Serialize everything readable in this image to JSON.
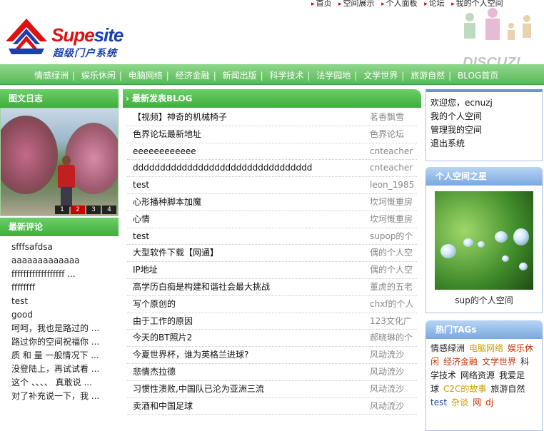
{
  "top_links": [
    "首页",
    "空间展示",
    "个人面板",
    "论坛",
    "我的个人空间"
  ],
  "logo": {
    "word_a": "Supe",
    "word_b": "site",
    "sub": "超级门户系统"
  },
  "discuz": "DISCUZ!",
  "nav": [
    "情感绿洲",
    "娱乐休闲",
    "电脑网络",
    "经济金融",
    "新闻出版",
    "科学技术",
    "法学园地",
    "文学世界",
    "旅游自然",
    "BLOG首页"
  ],
  "left": {
    "photo_title": "图文日志",
    "pager": [
      "1",
      "2",
      "3",
      "4"
    ],
    "comments_title": "最新评论",
    "comments": [
      "sfffsafdsa",
      "aaaaaaaaaaaaa",
      "ffffffffffffffffff ...",
      "ffffffff",
      "test",
      "good",
      "呵呵，我也是路过的 ...",
      "路过你的空间祝福你 ...",
      "质 和 量 一般情况下 ...",
      "没登陆上，再试试看 ...",
      "这个 、、、、 真敢说 ...",
      "对了补充说一下，我 ..."
    ]
  },
  "blog": {
    "title": "最新发表BLOG",
    "rows": [
      {
        "title": "【视频】神奇的机械椅子",
        "author": "茗香飘雪"
      },
      {
        "title": "色界论坛最新地址",
        "author": "色界论坛"
      },
      {
        "title": "eeeeeeeeeeee",
        "author": "cnteacher"
      },
      {
        "title": "ddddddddddddddddddddddddddddddddd",
        "author": "cnteacher"
      },
      {
        "title": "test",
        "author": "leon_1985"
      },
      {
        "title": "心形播种脚本加魔",
        "author": "坎坷慨重房"
      },
      {
        "title": "心情",
        "author": "坎坷慨重房"
      },
      {
        "title": "test",
        "author": "supop的个"
      },
      {
        "title": "大型软件下载【网通】",
        "author": "偶的个人空"
      },
      {
        "title": "IP地址",
        "author": "偶的个人空"
      },
      {
        "title": "高学历白痴是构建和谐社会最大挑战",
        "author": "董虎的五老"
      },
      {
        "title": "写个原创的",
        "author": "chxf的个人"
      },
      {
        "title": "由于工作的原因",
        "author": "123文化广"
      },
      {
        "title": "今天的BT照片2",
        "author": "郝晓琳的个"
      },
      {
        "title": "今夏世界杯，谁为英格兰进球?",
        "author": "风动流沙"
      },
      {
        "title": "悲情杰拉德",
        "author": "风动流沙"
      },
      {
        "title": "习惯性溃败,中国队已沦为亚洲三流",
        "author": "风动流沙"
      },
      {
        "title": "卖酒和中国足球",
        "author": "风动流沙"
      }
    ]
  },
  "right": {
    "user_links": [
      "欢迎您，ecnuzj",
      "我的个人空间",
      "管理我的空间",
      "退出系统"
    ],
    "star_title": "个人空间之星",
    "star_caption": "sup的个人空间",
    "tags_title": "热门TAGs",
    "tags": [
      {
        "text": "情感绿洲",
        "color": "#222222"
      },
      {
        "text": "电脑网络",
        "color": "#c8a000"
      },
      {
        "text": "娱乐休闲",
        "color": "#c83000"
      },
      {
        "text": "经济金融",
        "color": "#c83000"
      },
      {
        "text": "文学世界",
        "color": "#c83000"
      },
      {
        "text": "科学技术",
        "color": "#222222"
      },
      {
        "text": "网络资源",
        "color": "#222222"
      },
      {
        "text": "我爱足球",
        "color": "#222222"
      },
      {
        "text": "C2C的故事",
        "color": "#c8a000"
      },
      {
        "text": "旅游自然",
        "color": "#222222"
      },
      {
        "text": "test",
        "color": "#2040a0"
      },
      {
        "text": "杂谈",
        "color": "#c8a000"
      },
      {
        "text": "网",
        "color": "#c83000"
      },
      {
        "text": "dj",
        "color": "#c83000"
      }
    ]
  }
}
